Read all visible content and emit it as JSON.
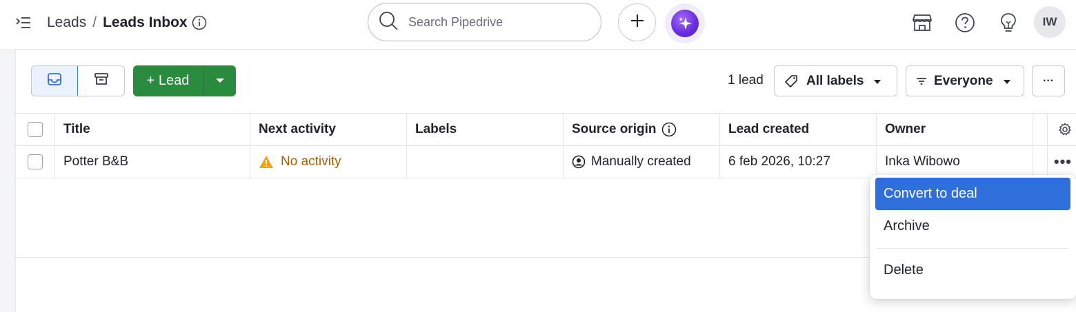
{
  "header": {
    "breadcrumb_parent": "Leads",
    "breadcrumb_separator": "/",
    "breadcrumb_current": "Leads Inbox",
    "search_placeholder": "Search Pipedrive",
    "avatar_initials": "IW",
    "icons": [
      "menu-toggle-icon",
      "info-icon",
      "search-icon",
      "plus-icon",
      "ai-sparkle-icon",
      "marketplace-icon",
      "help-icon",
      "lightbulb-icon"
    ]
  },
  "toolbar": {
    "views": [
      "inbox-icon",
      "archive-icon"
    ],
    "active_view": "inbox",
    "add_lead_label": "+ Lead",
    "lead_count": "1 lead",
    "labels_filter": "All labels",
    "owner_filter": "Everyone",
    "more_label": "···",
    "accent_color": "#2a8a3e"
  },
  "table": {
    "columns": [
      "Title",
      "Next activity",
      "Labels",
      "Source origin",
      "Lead created",
      "Owner"
    ],
    "rows": [
      {
        "title": "Potter B&B",
        "next_activity": "No activity",
        "labels": "",
        "source_origin": "Manually created",
        "lead_created": "6 feb 2026, 10:27",
        "owner": "Inka Wibowo"
      }
    ],
    "row_actions_label": "•••"
  },
  "context_menu": {
    "items": [
      "Convert to deal",
      "Archive",
      "Delete"
    ],
    "highlighted": "Convert to deal",
    "highlight_color": "#2f6fdb"
  }
}
